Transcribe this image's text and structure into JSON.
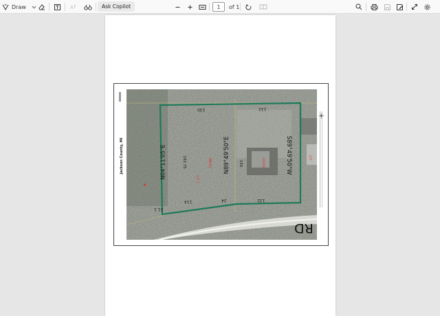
{
  "toolbar": {
    "draw_label": "Draw",
    "ask_copilot_label": "Ask Copilot",
    "page_number": "1",
    "page_total": "of 1"
  },
  "map": {
    "county_label": "Jackson County, MI",
    "road_label": "RD",
    "bearings": {
      "top": "N89°49'50\"E",
      "left": "N04°11'05\"E",
      "right": "S89°49'50\"W"
    },
    "dimensions": {
      "top_left": "130",
      "top_right": "112",
      "bottom_left": "114",
      "bottom_mid": "24",
      "bottom_right": "132",
      "left_side": "51.1",
      "inner_left": "192.75",
      "inner_mid": "150"
    }
  }
}
